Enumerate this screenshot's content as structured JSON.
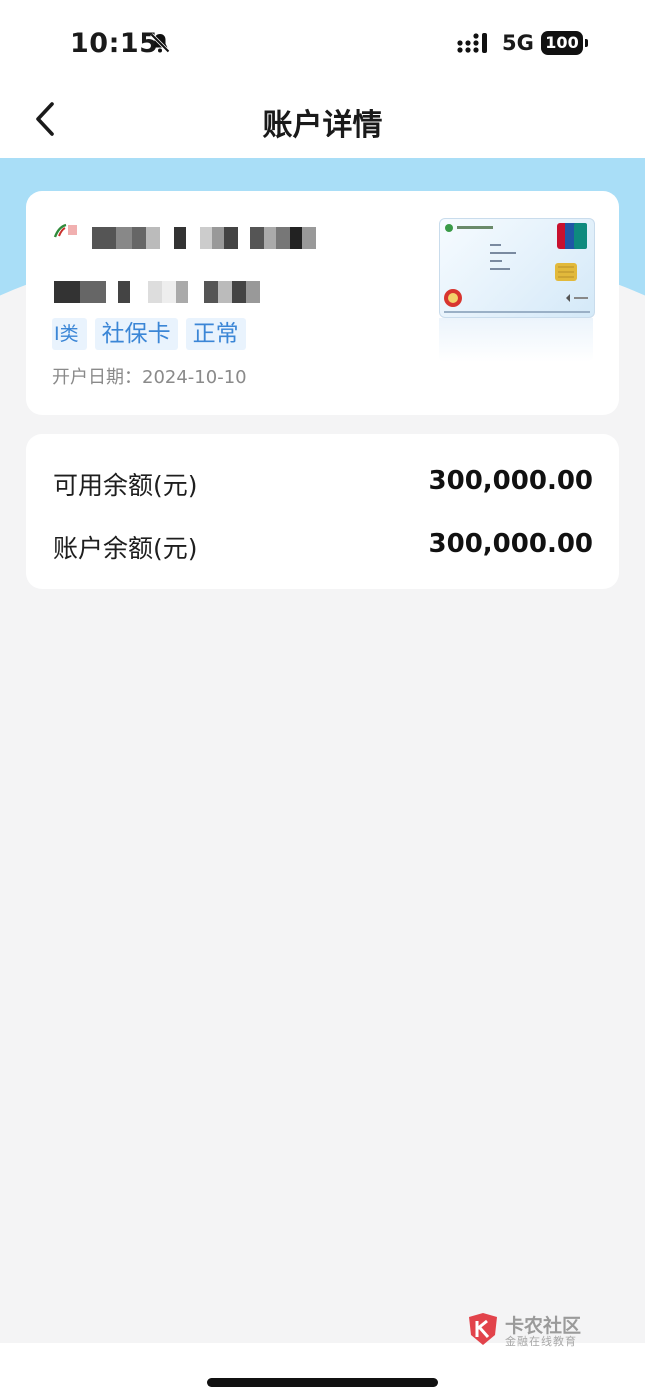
{
  "status_bar": {
    "time": "10:15",
    "network": "5G",
    "battery": "100"
  },
  "nav": {
    "title": "账户详情"
  },
  "account": {
    "tags": [
      "I类",
      "社保卡",
      "正常"
    ],
    "tag_partial": "I类",
    "open_date": "开户日期：2024-10-10"
  },
  "balances": [
    {
      "label": "可用余额(元)",
      "value": "300,000.00"
    },
    {
      "label": "账户余额(元)",
      "value": "300,000.00"
    }
  ],
  "watermark": {
    "name": "卡农社区",
    "sub": "金融在线教育"
  },
  "colors": {
    "accent_blue": "#3b86d6",
    "band_blue": "#a9def7",
    "watermark_red": "#e2434b"
  }
}
